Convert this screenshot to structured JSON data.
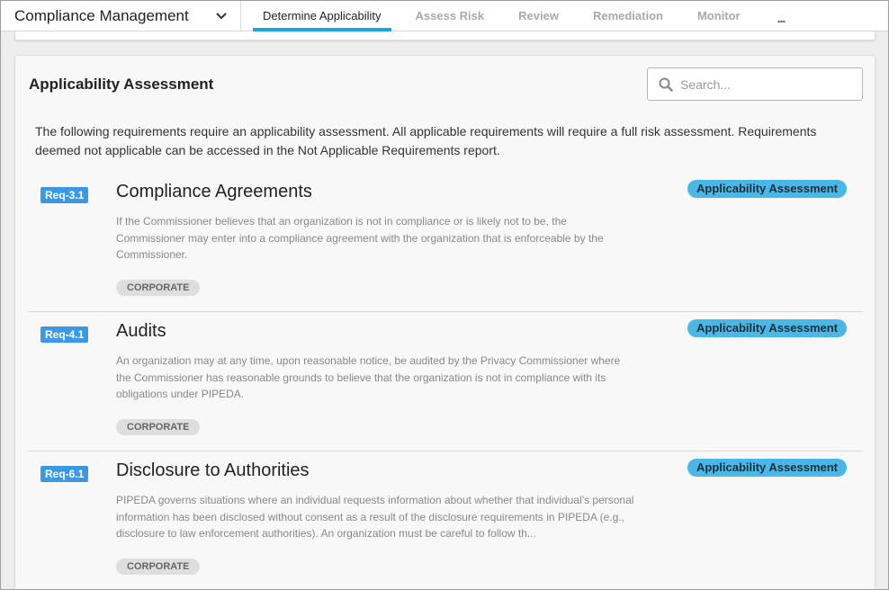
{
  "app": {
    "title": "Compliance Management"
  },
  "tabs": [
    {
      "label": "Determine Applicability",
      "active": true
    },
    {
      "label": "Assess Risk",
      "active": false
    },
    {
      "label": "Review",
      "active": false
    },
    {
      "label": "Remediation",
      "active": false
    },
    {
      "label": "Monitor",
      "active": false
    }
  ],
  "more_label": "...",
  "panel": {
    "title": "Applicability Assessment",
    "search_placeholder": "Search...",
    "intro": "The following requirements require an applicability assessment. All applicable requirements will require a full risk assessment. Requirements deemed not applicable can be accessed in the Not Applicable Requirements report."
  },
  "requirements": [
    {
      "id": "Req-3.1",
      "title": "Compliance Agreements",
      "description": "If the Commissioner believes that an organization is not in compliance or is likely not to be, the Commissioner may enter into a compliance agreement with the organization that is enforceable by the Commissioner.",
      "tag": "CORPORATE",
      "status": "Applicability Assessment"
    },
    {
      "id": "Req-4.1",
      "title": "Audits",
      "description": "An organization may at any time, upon reasonable notice, be audited by the Privacy Commissioner where the Commissioner has reasonable grounds to believe that the organization is not in compliance with its obligations under PIPEDA.",
      "tag": "CORPORATE",
      "status": "Applicability Assessment"
    },
    {
      "id": "Req-6.1",
      "title": "Disclosure to Authorities",
      "description": "PIPEDA governs situations where an individual requests information about whether that individual’s personal information has been disclosed without consent as a result of the disclosure requirements in PIPEDA (e.g., disclosure to law enforcement authorities). An organization must be careful to follow th...",
      "tag": "CORPORATE",
      "status": "Applicability Assessment"
    }
  ],
  "colors": {
    "accent": "#1aa6df",
    "req_id_badge": "#3b98e4",
    "status_pill": "#4ab8e6",
    "tag_bg": "#dedede"
  },
  "icons": {
    "chevron": "chevron-down-icon",
    "search": "search-icon",
    "more": "more-horizontal-icon"
  }
}
